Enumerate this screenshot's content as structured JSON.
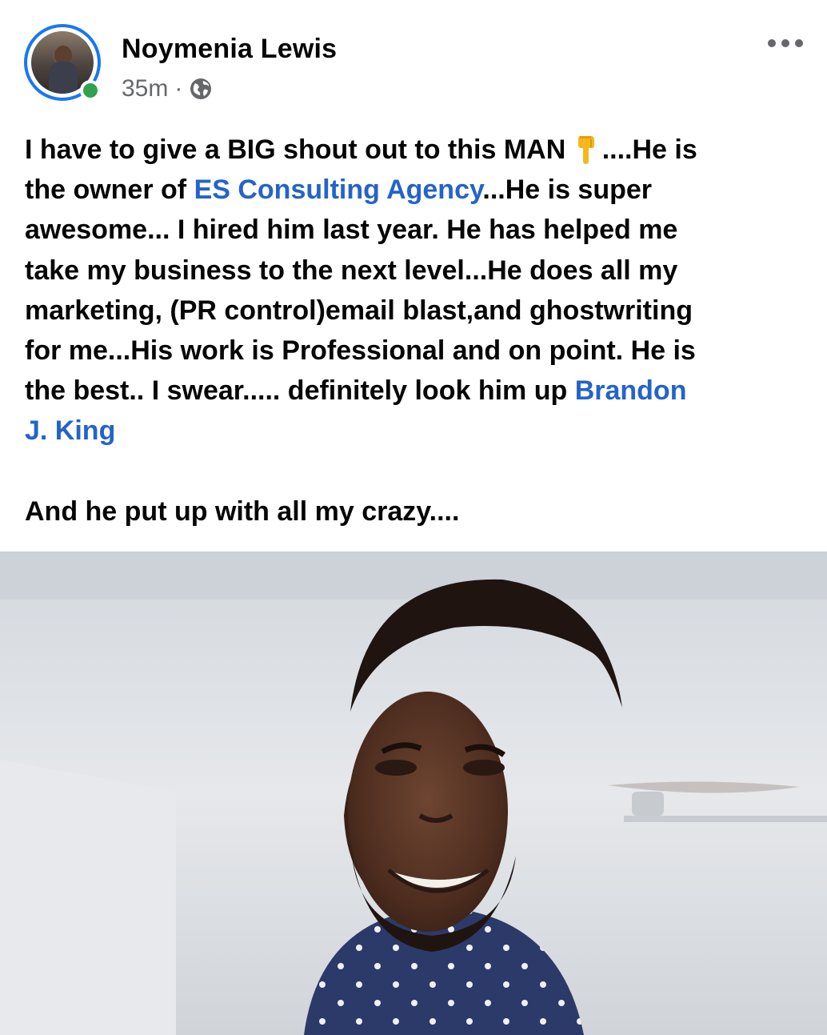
{
  "post": {
    "author": "Noymenia Lewis",
    "time": "35m",
    "separator": "·",
    "privacy_icon": "globe-icon",
    "menu_icon": "more-dots-icon",
    "online": true,
    "lines": {
      "l1_a": "I have to give a BIG shout out  to this MAN",
      "l1_b": "....He is",
      "l2_a": "the owner of ",
      "l2_link": "ES Consulting Agency",
      "l2_b": "...He is super",
      "l3": "awesome... I hired him last year. He has helped me",
      "l4": "take my business to the next level...He does all my",
      "l5": "marketing,  (PR control)email blast,and ghostwriting",
      "l6": "for me...His work is Professional and on point. He is",
      "l7_a": "the best.. I swear..... definitely look him up ",
      "l7_link": "Brandon",
      "l8_link": "J. King",
      "l9": "And he put up with all my crazy...."
    },
    "emoji": "pointing-down-emoji",
    "photo": "portrait-photo"
  },
  "colors": {
    "link": "#2563c9",
    "online": "#31a24c",
    "avatar_ring": "#1877f2",
    "meta_text": "#65676b"
  }
}
